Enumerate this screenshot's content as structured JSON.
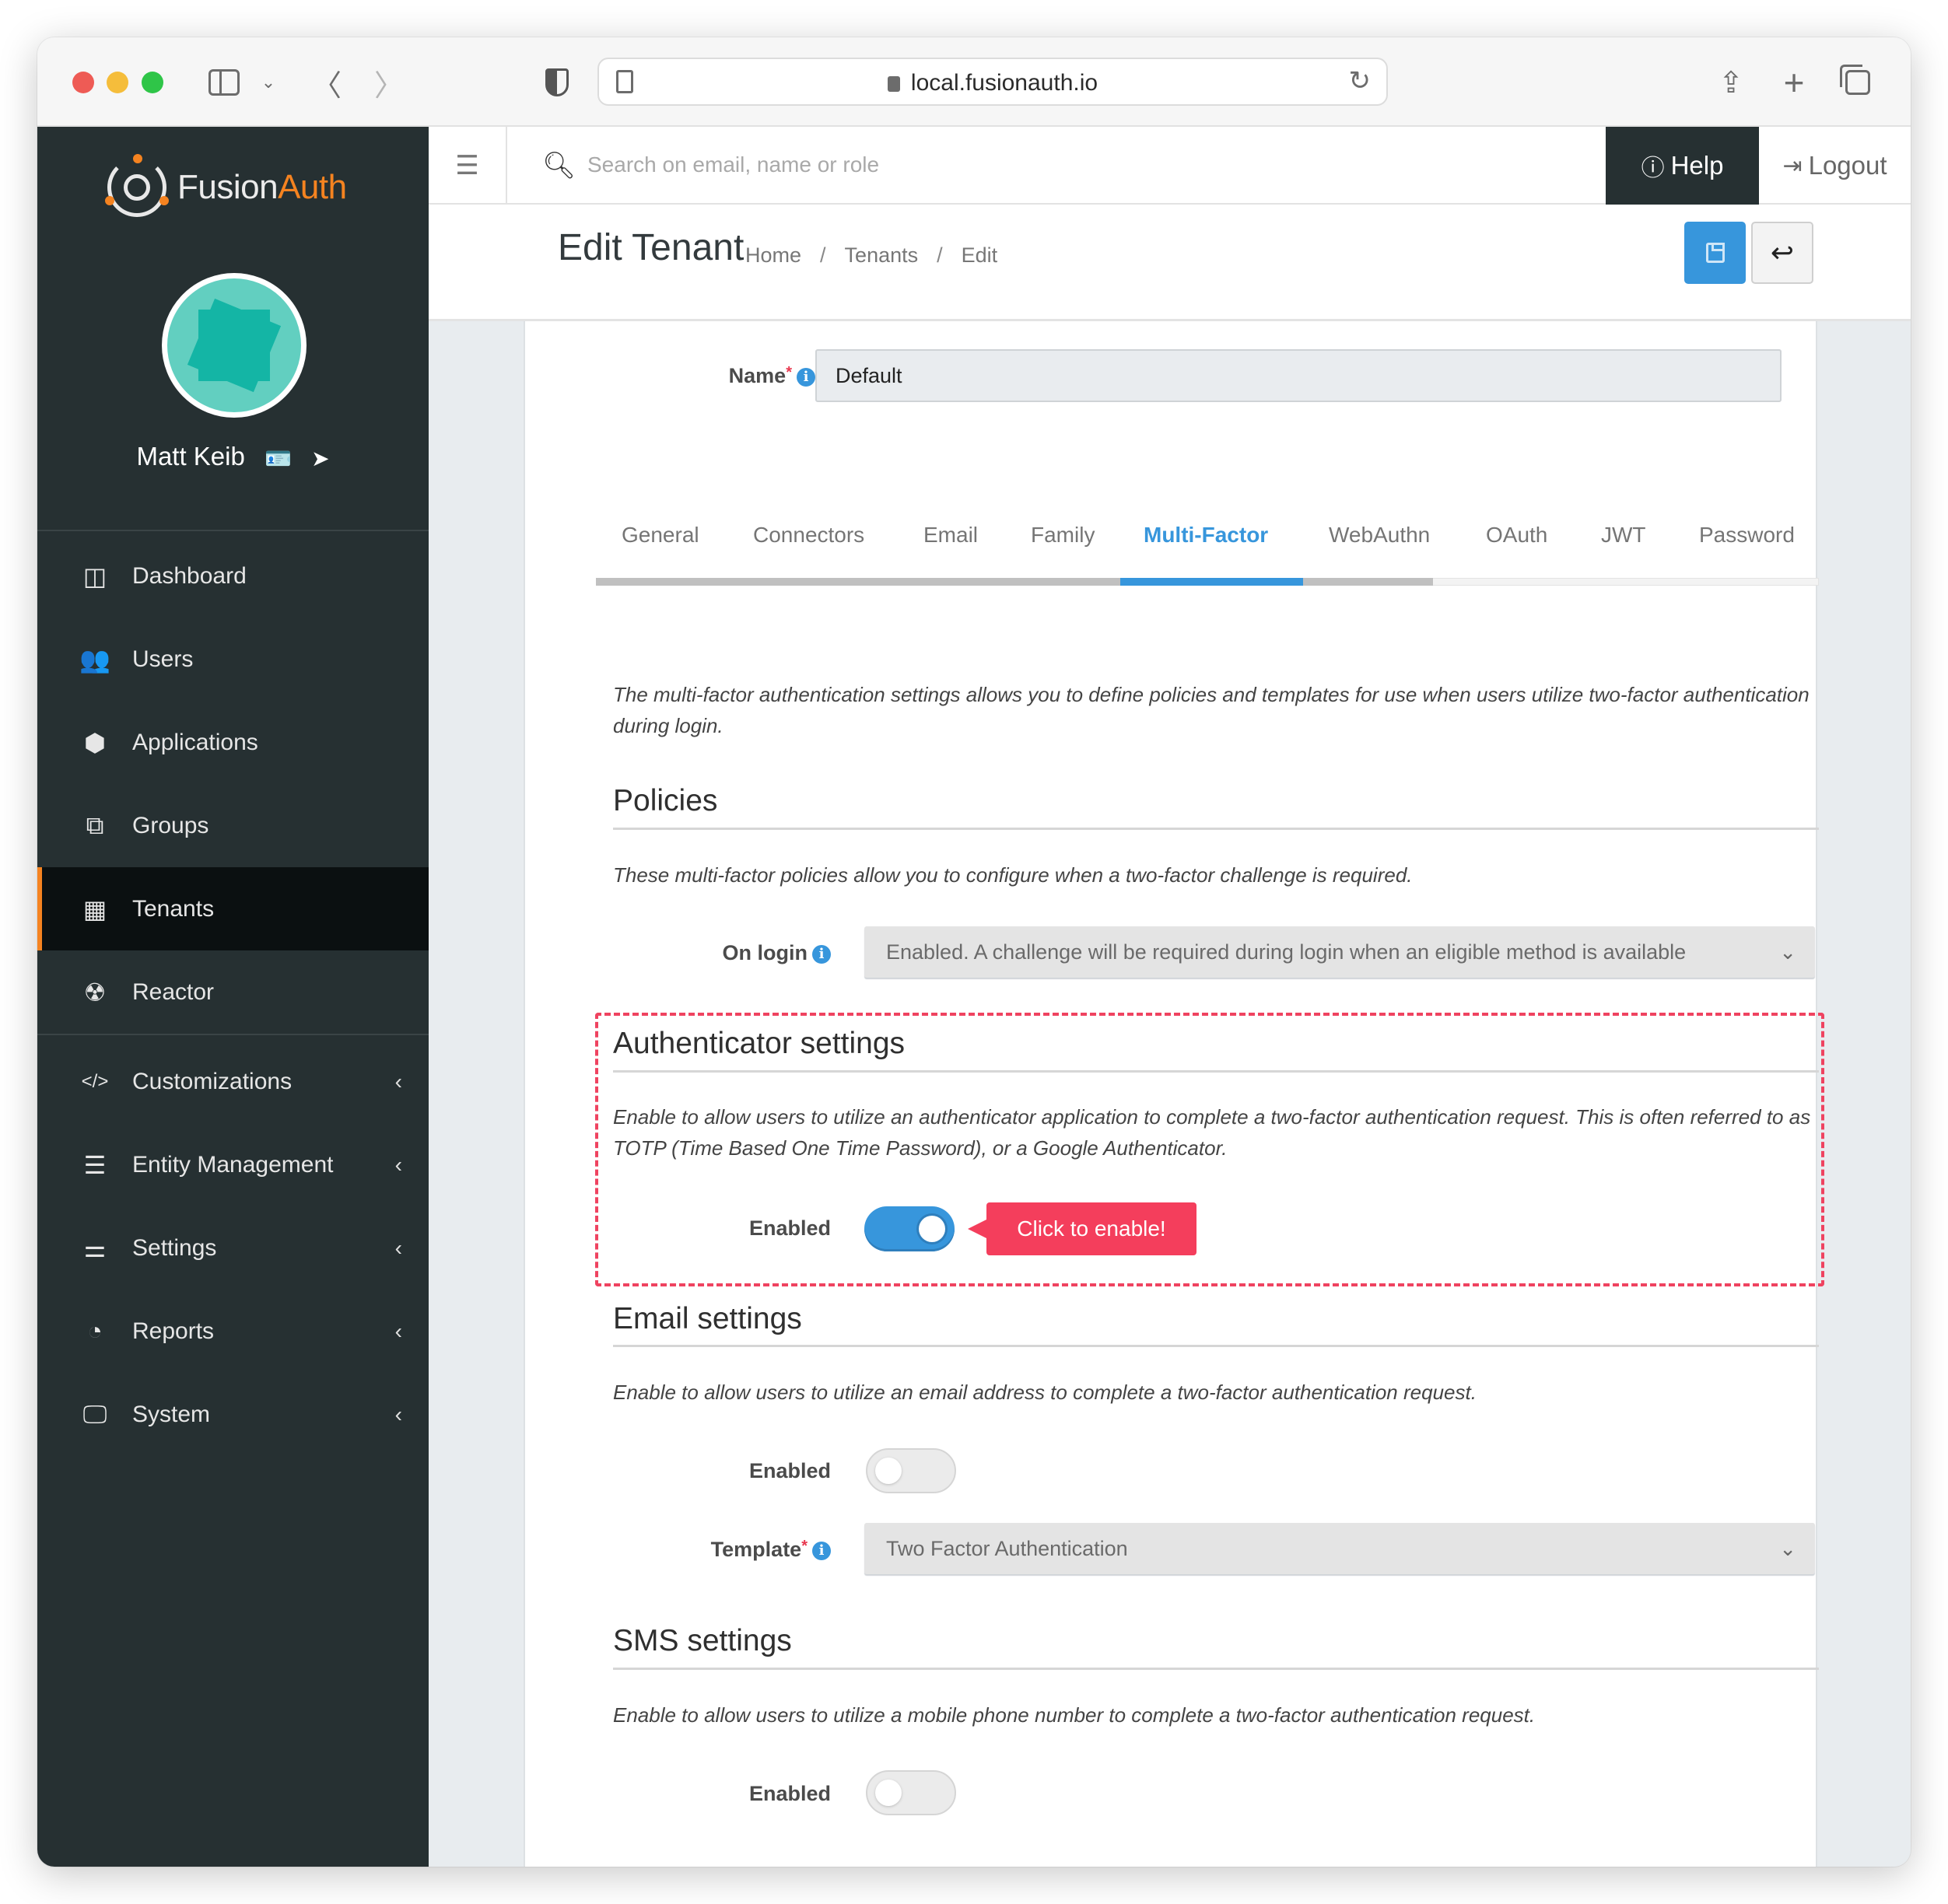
{
  "browser": {
    "url": "local.fusionauth.io",
    "icons": [
      "sidebar-toggle-icon",
      "chevron-down-icon",
      "back-icon",
      "forward-icon",
      "shield-icon",
      "page-icon",
      "lock-icon",
      "reload-icon",
      "share-icon",
      "new-tab-icon",
      "tab-overview-icon"
    ]
  },
  "brand": {
    "name_primary": "Fusion",
    "name_accent": "Auth",
    "accent_color": "#f58320"
  },
  "user": {
    "name": "Matt Keib",
    "icons": [
      "id-card-icon",
      "location-arrow-icon"
    ]
  },
  "sidebar": {
    "items": [
      {
        "label": "Dashboard",
        "icon": "dashboard-icon",
        "glyph": "◫",
        "active": false,
        "expandable": false
      },
      {
        "label": "Users",
        "icon": "users-icon",
        "glyph": "👥",
        "active": false,
        "expandable": false
      },
      {
        "label": "Applications",
        "icon": "cube-icon",
        "glyph": "⬢",
        "active": false,
        "expandable": false
      },
      {
        "label": "Groups",
        "icon": "groups-icon",
        "glyph": "⧉",
        "active": false,
        "expandable": false
      },
      {
        "label": "Tenants",
        "icon": "building-icon",
        "glyph": "▦",
        "active": true,
        "expandable": false
      },
      {
        "label": "Reactor",
        "icon": "reactor-icon",
        "glyph": "☢",
        "active": false,
        "expandable": false
      },
      {
        "label": "Customizations",
        "icon": "code-icon",
        "glyph": "</>",
        "active": false,
        "expandable": true
      },
      {
        "label": "Entity Management",
        "icon": "server-icon",
        "glyph": "☰",
        "active": false,
        "expandable": true
      },
      {
        "label": "Settings",
        "icon": "sliders-icon",
        "glyph": "⚌",
        "active": false,
        "expandable": true
      },
      {
        "label": "Reports",
        "icon": "pie-chart-icon",
        "glyph": "◔",
        "active": false,
        "expandable": true
      },
      {
        "label": "System",
        "icon": "desktop-icon",
        "glyph": "🖵",
        "active": false,
        "expandable": true
      }
    ],
    "expand_glyph": "‹"
  },
  "appbar": {
    "search_placeholder": "Search on email, name or role",
    "help_label": "Help",
    "logout_label": "Logout"
  },
  "header": {
    "title": "Edit Tenant",
    "breadcrumb": [
      "Home",
      "Tenants",
      "Edit"
    ],
    "breadcrumb_sep": "/"
  },
  "form": {
    "name_label": "Name",
    "name_value": "Default",
    "tabs": [
      "General",
      "Connectors",
      "Email",
      "Family",
      "Multi-Factor",
      "WebAuthn",
      "OAuth",
      "JWT",
      "Password"
    ],
    "active_tab": "Multi-Factor",
    "intro": "The multi-factor authentication settings allows you to define policies and templates for use when users utilize two-factor authentication during login.",
    "policies": {
      "title": "Policies",
      "description": "These multi-factor policies allow you to configure when a two-factor challenge is required.",
      "on_login_label": "On login",
      "on_login_value": "Enabled. A challenge will be required during login when an eligible method is available"
    },
    "authenticator": {
      "title": "Authenticator settings",
      "description": "Enable to allow users to utilize an authenticator application to complete a two-factor authentication request. This is often referred to as TOTP (Time Based One Time Password), or a Google Authenticator.",
      "enabled_label": "Enabled",
      "enabled": true,
      "callout": "Click to enable!"
    },
    "email": {
      "title": "Email settings",
      "description": "Enable to allow users to utilize an email address to complete a two-factor authentication request.",
      "enabled_label": "Enabled",
      "enabled": false,
      "template_label": "Template",
      "template_value": "Two Factor Authentication"
    },
    "sms": {
      "title": "SMS settings",
      "description": "Enable to allow users to utilize a mobile phone number to complete a two-factor authentication request.",
      "enabled_label": "Enabled",
      "enabled": false
    }
  },
  "colors": {
    "sidebar_bg": "#263032",
    "primary": "#3796dc",
    "callout": "#f43e5c",
    "highlight_border": "#ef4360"
  }
}
